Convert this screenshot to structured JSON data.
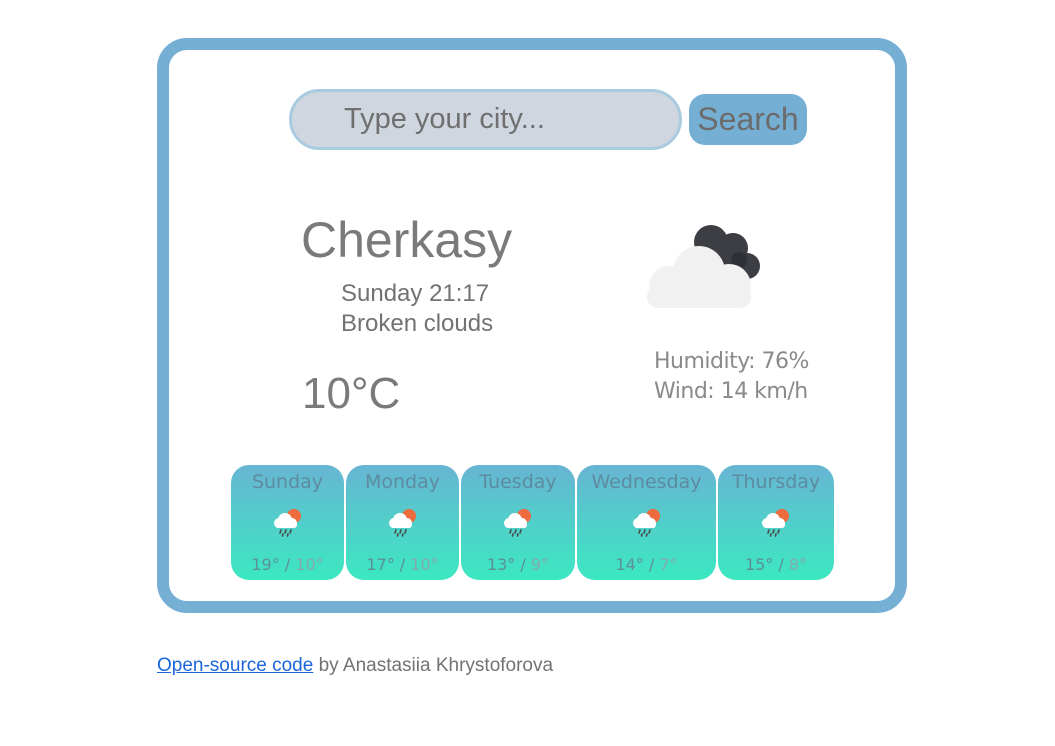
{
  "search": {
    "placeholder": "Type your city...",
    "button_label": "Search"
  },
  "current": {
    "city": "Cherkasy",
    "date_time": "Sunday 21:17",
    "description": "Broken clouds",
    "temperature": "10°C",
    "icon": "broken-clouds-icon",
    "humidity": "Humidity: 76%",
    "wind": "Wind: 14 km/h"
  },
  "forecast": [
    {
      "day": "Sunday",
      "max": "19°",
      "min": "10°",
      "icon": "rain-sun-icon"
    },
    {
      "day": "Monday",
      "max": "17°",
      "min": "10°",
      "icon": "rain-sun-icon"
    },
    {
      "day": "Tuesday",
      "max": "13°",
      "min": "9°",
      "icon": "rain-sun-icon"
    },
    {
      "day": "Wednesday",
      "max": "14°",
      "min": "7°",
      "icon": "rain-sun-icon"
    },
    {
      "day": "Thursday",
      "max": "15°",
      "min": "8°",
      "icon": "rain-sun-icon"
    }
  ],
  "footer": {
    "link_text": "Open-source code",
    "by_text": " by Anastasiia Khrystoforova"
  },
  "colors": {
    "frame": "#76afd4",
    "input_bg": "#cfd6e0",
    "forecast_top": "#67b5d3",
    "forecast_bottom": "#3be8c1",
    "link": "#1a66d8"
  }
}
